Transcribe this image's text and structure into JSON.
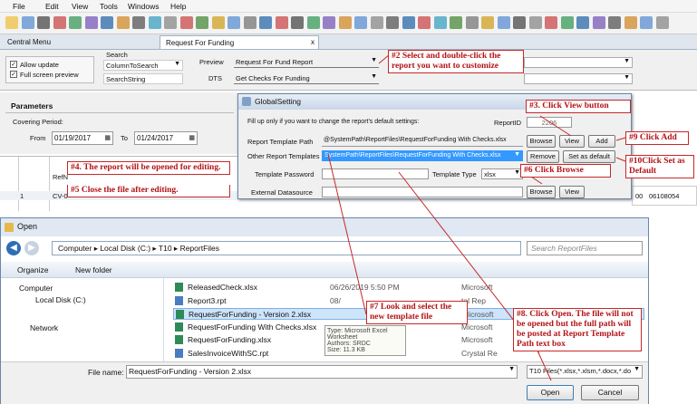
{
  "menu": [
    "File",
    "Edit",
    "View",
    "Tools",
    "Windows",
    "Help"
  ],
  "tabs": {
    "central": "Central Menu",
    "request": "Request For Funding",
    "close": "x"
  },
  "options": {
    "search_label": "Search",
    "allow_update": "Allow update",
    "full_screen": "Full screen preview",
    "column_to_search": "ColumnToSearch",
    "search_string": "SearchString",
    "preview_label": "Preview",
    "preview_value": "Request For Fund Report",
    "dts_label": "DTS",
    "dts_value": "Get Checks For Funding"
  },
  "parameters": {
    "title": "Parameters",
    "covering": "Covering Period:",
    "from_label": "From",
    "from_value": "01/19/2017",
    "to_label": "To",
    "to_value": "01/24/2017"
  },
  "grid": {
    "ref": "RefN",
    "row": "1",
    "cv": "CV-0",
    "num1": "00",
    "num2": "06108054"
  },
  "global_setting": {
    "title": "GlobalSetting",
    "note": "Fill up only if you want to change the report's default settings:",
    "report_id_label": "ReportID",
    "report_id": "2206",
    "template_path_label": "Report Template Path",
    "template_path": "@SystemPath\\ReportFiles\\RequestForFunding With Checks.xlsx",
    "other_templates_label": "Other Report Templates",
    "other_templates": "SystemPath\\ReportFiles\\RequestForFunding With Checks.xlsx",
    "password_label": "Template Password",
    "type_label": "Template Type",
    "type_value": "xlsx",
    "datasource_label": "External Datasource",
    "browse": "Browse",
    "view": "View",
    "add": "Add",
    "remove": "Remove",
    "set_default": "Set as default"
  },
  "open_dialog": {
    "title": "Open",
    "path": [
      "Computer",
      "Local Disk (C:)",
      "T10",
      "ReportFiles"
    ],
    "search_placeholder": "Search ReportFiles",
    "organize": "Organize",
    "new_folder": "New folder",
    "nav": {
      "computer": "Computer",
      "local_disk": "Local Disk (C:)",
      "network": "Network"
    },
    "files": [
      {
        "name": "ReleasedCheck.xlsx",
        "date": "06/26/2019 5:50 PM",
        "type": "Microsoft"
      },
      {
        "name": "Report3.rpt",
        "date": "08/",
        "type": "tal Rep"
      },
      {
        "name": "RequestForFunding - Version 2.xlsx",
        "date": "",
        "type": "Microsoft"
      },
      {
        "name": "RequestForFunding With Checks.xlsx",
        "date": "",
        "type": "Microsoft"
      },
      {
        "name": "RequestForFunding.xlsx",
        "date": "",
        "type": "Microsoft"
      },
      {
        "name": "SalesInvoiceWithSC.rpt",
        "date": "12/01/2015 5:26 PM",
        "type": "Crystal Re"
      }
    ],
    "tooltip": [
      "Type: Microsoft Excel Worksheet",
      "Authors: SRDC",
      "Size: 11.3 KB"
    ],
    "filename_label": "File name:",
    "filename": "RequestForFunding - Version 2.xlsx",
    "filter": "T10 Files(*.xlsx,*.xlsm,*.docx,*.do",
    "open_btn": "Open",
    "cancel_btn": "Cancel"
  },
  "callouts": {
    "c2": "#2 Select and double-click the report you want to customize",
    "c3": "#3. Click View button",
    "c4": "#4. The report will be opened for editing.",
    "c5": "#5  Close the file after editing.",
    "c6": "#6 Click Browse",
    "c7": "#7 Look and select the new template file",
    "c8": "#8. Click Open. The file will not be opened but the full path will be posted at Report Template Path text box",
    "c9": "#9  Click Add",
    "c10": "#10Click Set as Default"
  },
  "colors": {
    "annotation": "#c62828",
    "selection": "#3399ff"
  }
}
